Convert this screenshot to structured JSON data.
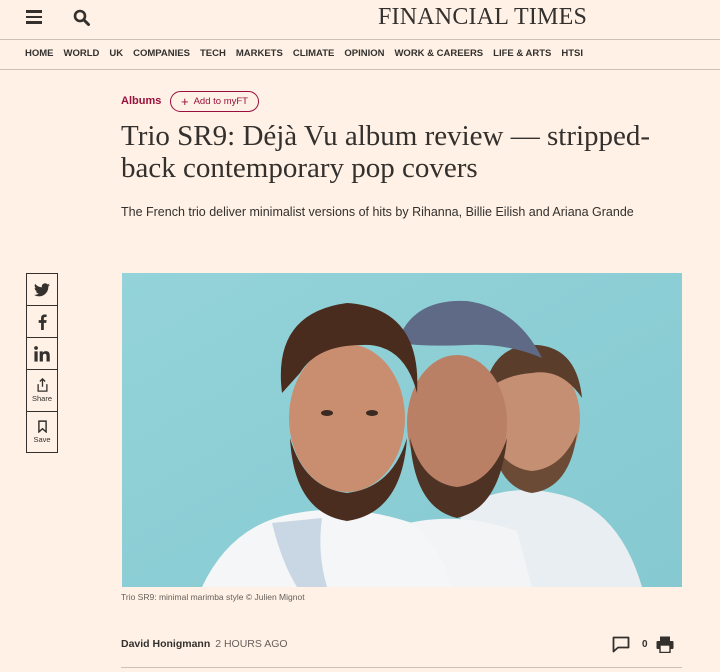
{
  "masthead": {
    "title": "FINANCIAL TIMES"
  },
  "nav": {
    "items": [
      "HOME",
      "WORLD",
      "UK",
      "COMPANIES",
      "TECH",
      "MARKETS",
      "CLIMATE",
      "OPINION",
      "WORK & CAREERS",
      "LIFE & ARTS",
      "HTSI"
    ]
  },
  "article": {
    "topic": "Albums",
    "myft_label": "Add to myFT",
    "headline": "Trio SR9: Déjà Vu album review — stripped-back contemporary pop covers",
    "standfirst": "The French trio deliver minimalist versions of hits by Rihanna, Billie Eilish and Ariana Grande",
    "caption": "Trio SR9: minimal marimba style © Julien Mignot",
    "author": "David Honigmann",
    "time": "2 HOURS AGO",
    "comment_count": "0"
  },
  "share": {
    "share_label": "Share",
    "save_label": "Save"
  },
  "colors": {
    "background": "#fff1e5",
    "accent": "#990f3d",
    "text": "#33302e",
    "photo_bg": "#8ecfd6"
  },
  "icons": [
    "menu-icon",
    "search-icon",
    "twitter-icon",
    "facebook-icon",
    "linkedin-icon",
    "share-icon",
    "bookmark-icon",
    "comment-icon",
    "print-icon"
  ]
}
